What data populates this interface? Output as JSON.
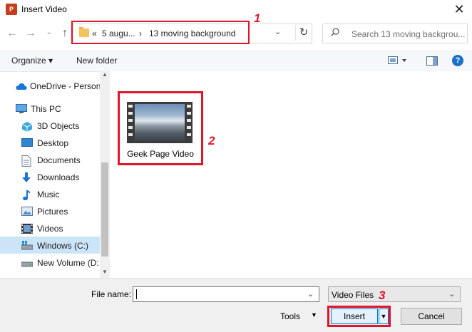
{
  "window": {
    "title": "Insert Video",
    "app_icon": "P",
    "close_glyph": "✕"
  },
  "nav": {
    "back_glyph": "←",
    "forward_glyph": "→",
    "recent_glyph": "⌄",
    "up_glyph": "↑",
    "address": {
      "overflow": "«",
      "crumbs": [
        "5 augu...",
        "13 moving background"
      ],
      "separator": "›",
      "dropdown": "⌄"
    },
    "refresh_glyph": "↻",
    "search_placeholder": "Search 13 moving backgrou..."
  },
  "toolbar": {
    "organize": "Organize ▾",
    "new_folder": "New folder",
    "help": "?"
  },
  "sidebar": {
    "items": [
      {
        "label": "OneDrive - Person",
        "icon": "cloud-icon"
      },
      {
        "label": "This PC",
        "icon": "computer-icon"
      },
      {
        "label": "3D Objects",
        "icon": "cube-icon"
      },
      {
        "label": "Desktop",
        "icon": "desktop-icon"
      },
      {
        "label": "Documents",
        "icon": "document-icon"
      },
      {
        "label": "Downloads",
        "icon": "download-icon"
      },
      {
        "label": "Music",
        "icon": "music-icon"
      },
      {
        "label": "Pictures",
        "icon": "pictures-icon"
      },
      {
        "label": "Videos",
        "icon": "videos-icon"
      },
      {
        "label": "Windows (C:)",
        "icon": "drive-icon"
      },
      {
        "label": "New Volume (D:",
        "icon": "drive-icon"
      }
    ],
    "selected": "Windows (C:)"
  },
  "files": [
    {
      "name": "Geek Page Video",
      "icon": "video-thumbnail"
    }
  ],
  "markers": [
    "1",
    "2",
    "3"
  ],
  "footer": {
    "file_name_label": "File name:",
    "file_name_value": "",
    "file_type": "Video Files",
    "tools": "Tools",
    "insert": "Insert",
    "cancel": "Cancel"
  },
  "colors": {
    "highlight": "#e0142a",
    "selected_bg": "#cce4f7",
    "accent": "#0078d4"
  }
}
